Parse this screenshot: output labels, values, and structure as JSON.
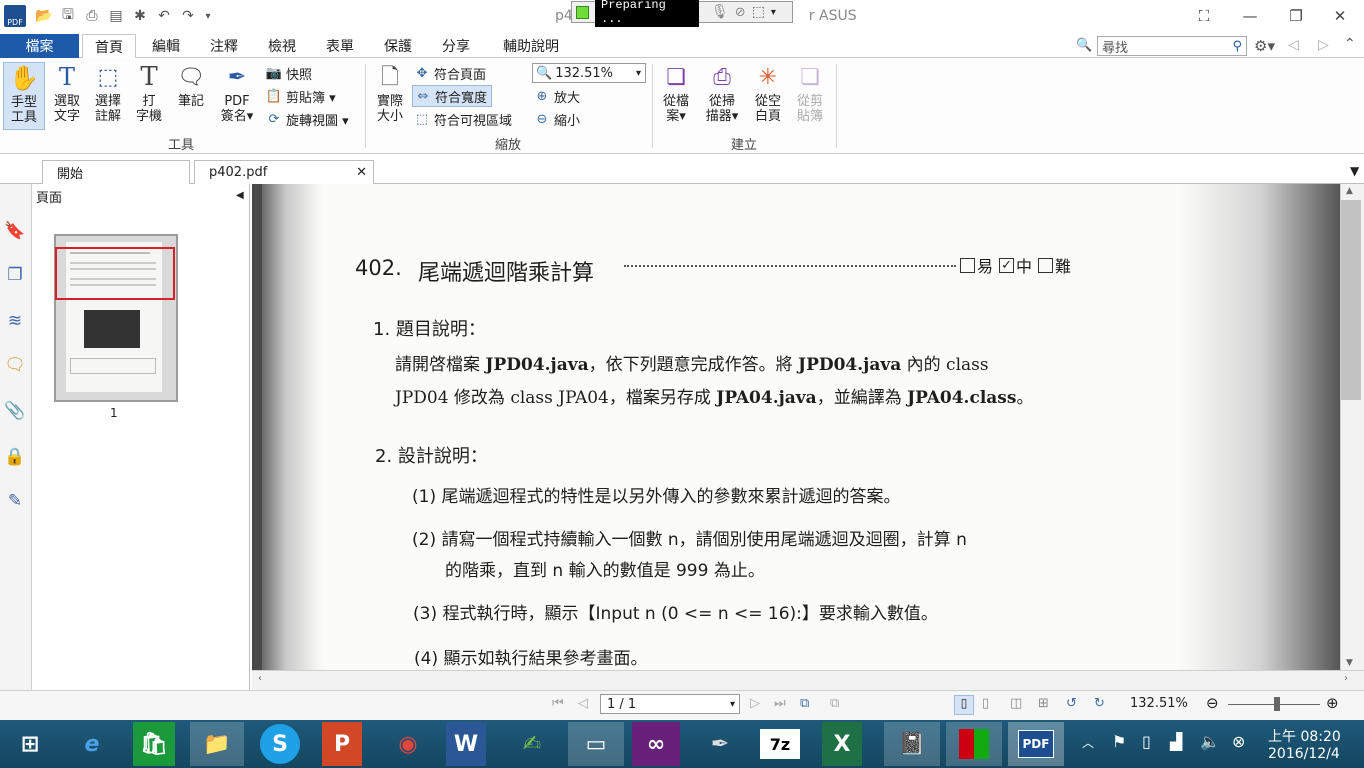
{
  "window": {
    "title_left": "p4",
    "title_right": "r ASUS"
  },
  "recorder": {
    "status": "Preparing ..."
  },
  "menu": {
    "file": "檔案",
    "tabs": [
      "首頁",
      "編輯",
      "注釋",
      "檢視",
      "表單",
      "保護",
      "分享",
      "輔助說明"
    ],
    "search_placeholder": "尋找"
  },
  "ribbon": {
    "tools": {
      "hand": "手型\n工具",
      "select_text": "選取\n文字",
      "select_annotation": "選擇\n註解",
      "typewriter": "打\n字機",
      "note": "筆記",
      "pdf_sign": "PDF\n簽名▾",
      "snapshot": "快照",
      "clipboard": "剪貼簿 ▾",
      "rotate": "旋轉視圖 ▾",
      "group": "工具"
    },
    "zoom": {
      "actual_size": "實際\n大小",
      "fit_page": "符合頁面",
      "fit_width": "符合寬度",
      "fit_visible": "符合可視區域",
      "zoom_value": "132.51%",
      "zoom_in": "放大",
      "zoom_out": "縮小",
      "group": "縮放"
    },
    "create": {
      "from_file": "從檔\n案▾",
      "from_scanner": "從掃\n描器▾",
      "blank": "從空\n白頁",
      "from_clipboard": "從剪\n貼簿",
      "group": "建立"
    }
  },
  "doc_tabs": [
    {
      "label": "開始"
    },
    {
      "label": "p402.pdf"
    }
  ],
  "pages_panel": {
    "title": "頁面",
    "thumb_label": "1"
  },
  "document": {
    "heading_num": "402.",
    "heading": "尾端遞迴階乘計算",
    "difficulty": {
      "easy": "易",
      "medium": "中",
      "hard": "難"
    },
    "sec1_title": "1. 題目說明：",
    "sec1_line1_a": "請開啓檔案 ",
    "sec1_line1_b": "JPD04.java",
    "sec1_line1_c": "，依下列題意完成作答。將 ",
    "sec1_line1_d": "JPD04.java",
    "sec1_line1_e": " 內的 class",
    "sec1_line2_a": "JPD04 修改為 class JPA04，檔案另存成 ",
    "sec1_line2_b": "JPA04.java",
    "sec1_line2_c": "，並編譯為 ",
    "sec1_line2_d": "JPA04.class",
    "sec1_line2_e": "。",
    "sec2_title": "2. 設計說明：",
    "items": [
      "(1) 尾端遞迴程式的特性是以另外傳入的參數來累計遞迴的答案。",
      "(2) 請寫一個程式持續輸入一個數 n，請個別使用尾端遞迴及迴圈，計算 n",
      "的階乘，直到 n 輸入的數值是 999 為止。",
      "(3) 程式執行時，顯示【Input n (0 <= n <= 16):】要求輸入數值。",
      "(4) 顯示如執行結果參考畫面。"
    ]
  },
  "status": {
    "page": "1 / 1",
    "zoom": "132.51%"
  },
  "taskbar": {
    "time": "上午 08:20",
    "date": "2016/12/4"
  },
  "colors": {
    "accent": "#1d5ba8",
    "taskbar": "#1a5270",
    "selection": "#d6202a"
  }
}
